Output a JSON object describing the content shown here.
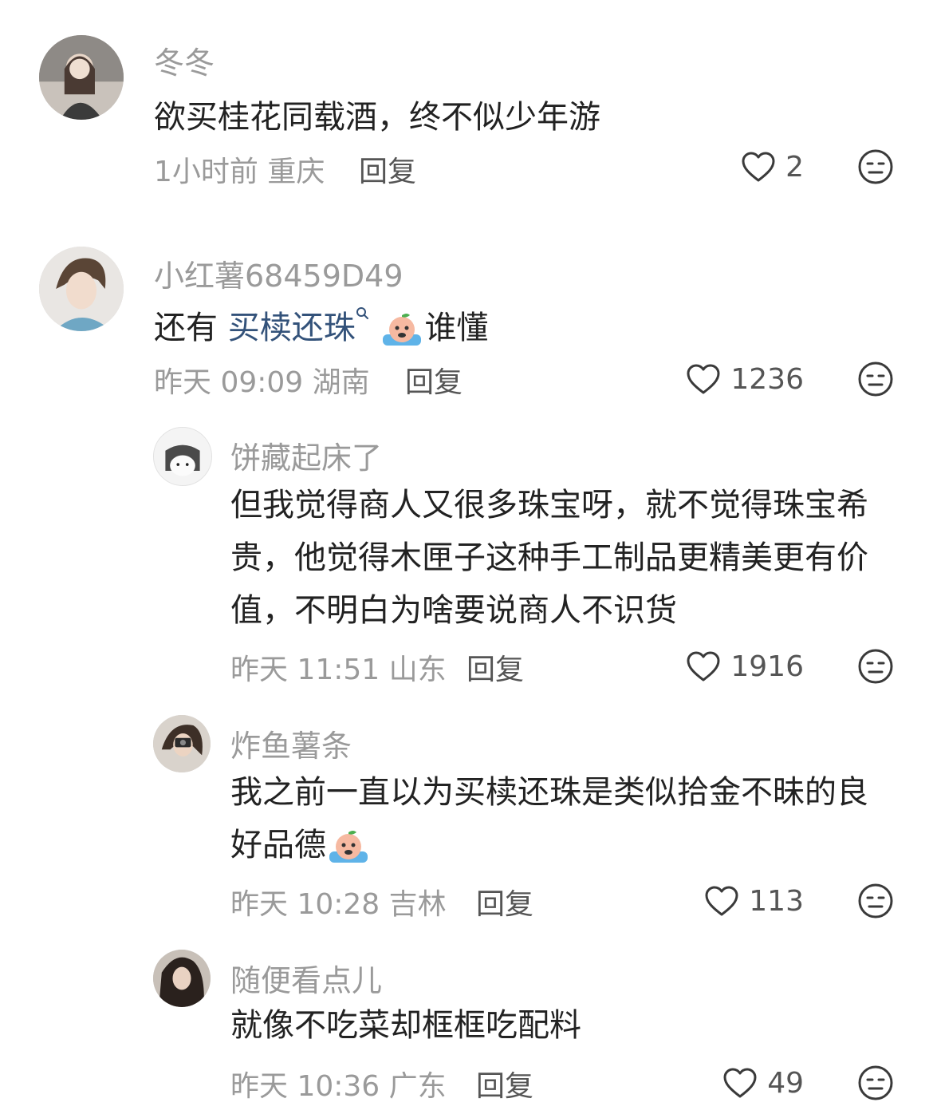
{
  "comments": [
    {
      "user": "冬冬",
      "text": "欲买桂花同载酒，终不似少年游",
      "meta": "1小时前 重庆",
      "reply": "回复",
      "likes": "2"
    },
    {
      "user": "小红薯68459D49",
      "text_prefix": "还有 ",
      "text_link": "买椟还珠",
      "text_suffix": "谁懂",
      "meta": "昨天 09:09 湖南",
      "reply": "回复",
      "likes": "1236"
    }
  ],
  "replies": [
    {
      "user": "饼藏起床了",
      "lines": [
        "但我觉得商人又很多珠宝呀，就不觉得珠宝希",
        "贵，他觉得木匣子这种手工制品更精美更有价",
        "值，不明白为啥要说商人不识货"
      ],
      "meta": "昨天 11:51 山东",
      "reply": "回复",
      "likes": "1916"
    },
    {
      "user": "炸鱼薯条",
      "lines": [
        "我之前一直以为买椟还珠是类似拾金不昧的良",
        "好品德"
      ],
      "meta": "昨天 10:28 吉林",
      "reply": "回复",
      "likes": "113"
    },
    {
      "user": "随便看点儿",
      "lines": [
        "就像不吃菜却框框吃配料"
      ],
      "meta": "昨天 10:36 广东",
      "reply": "回复",
      "likes": "49"
    }
  ],
  "icons": {
    "like": "heart-outline-icon",
    "dislike": "unamused-face-icon",
    "emoji": "crying-peach-emoji",
    "search": "search-icon"
  },
  "colors": {
    "username": "#9a9a9a",
    "link": "#33527a",
    "text": "#222222"
  }
}
